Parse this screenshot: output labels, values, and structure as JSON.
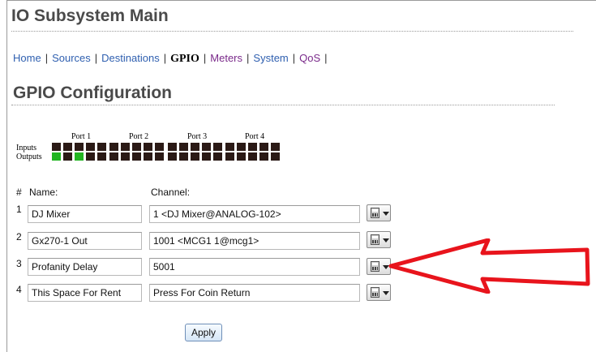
{
  "header": {
    "title": "IO Subsystem Main"
  },
  "nav": {
    "items": [
      {
        "label": "Home"
      },
      {
        "label": "Sources"
      },
      {
        "label": "Destinations"
      },
      {
        "label": "GPIO"
      },
      {
        "label": "Meters"
      },
      {
        "label": "System"
      },
      {
        "label": "QoS"
      }
    ],
    "separator": "|"
  },
  "section": {
    "title": "GPIO Configuration"
  },
  "gpio_matrix": {
    "ports": [
      "Port 1",
      "Port 2",
      "Port 3",
      "Port 4"
    ],
    "rows": [
      "Inputs",
      "Outputs"
    ],
    "inputs_active": [
      false,
      false,
      false,
      false,
      false,
      false,
      false,
      false,
      false,
      false,
      false,
      false,
      false,
      false,
      false,
      false,
      false,
      false,
      false,
      false
    ],
    "outputs_active": [
      true,
      false,
      true,
      false,
      false,
      false,
      false,
      false,
      false,
      false,
      false,
      false,
      false,
      false,
      false,
      false,
      false,
      false,
      false,
      false
    ],
    "colors": {
      "off": "#2b1a16",
      "on": "#22b522"
    }
  },
  "table": {
    "headers": {
      "num": "#",
      "name": "Name:",
      "channel": "Channel:"
    },
    "rows": [
      {
        "num": "1",
        "name": "DJ Mixer",
        "channel": "1 <DJ Mixer@ANALOG-102>"
      },
      {
        "num": "2",
        "name": "Gx270-1 Out",
        "channel": "1001 <MCG1 1@mcg1>"
      },
      {
        "num": "3",
        "name": "Profanity Delay",
        "channel": "5001"
      },
      {
        "num": "4",
        "name": "This Space For Rent",
        "channel": "Press For Coin Return"
      }
    ]
  },
  "actions": {
    "apply_label": "Apply"
  },
  "annotation": {
    "arrow_color": "#e8141c"
  }
}
